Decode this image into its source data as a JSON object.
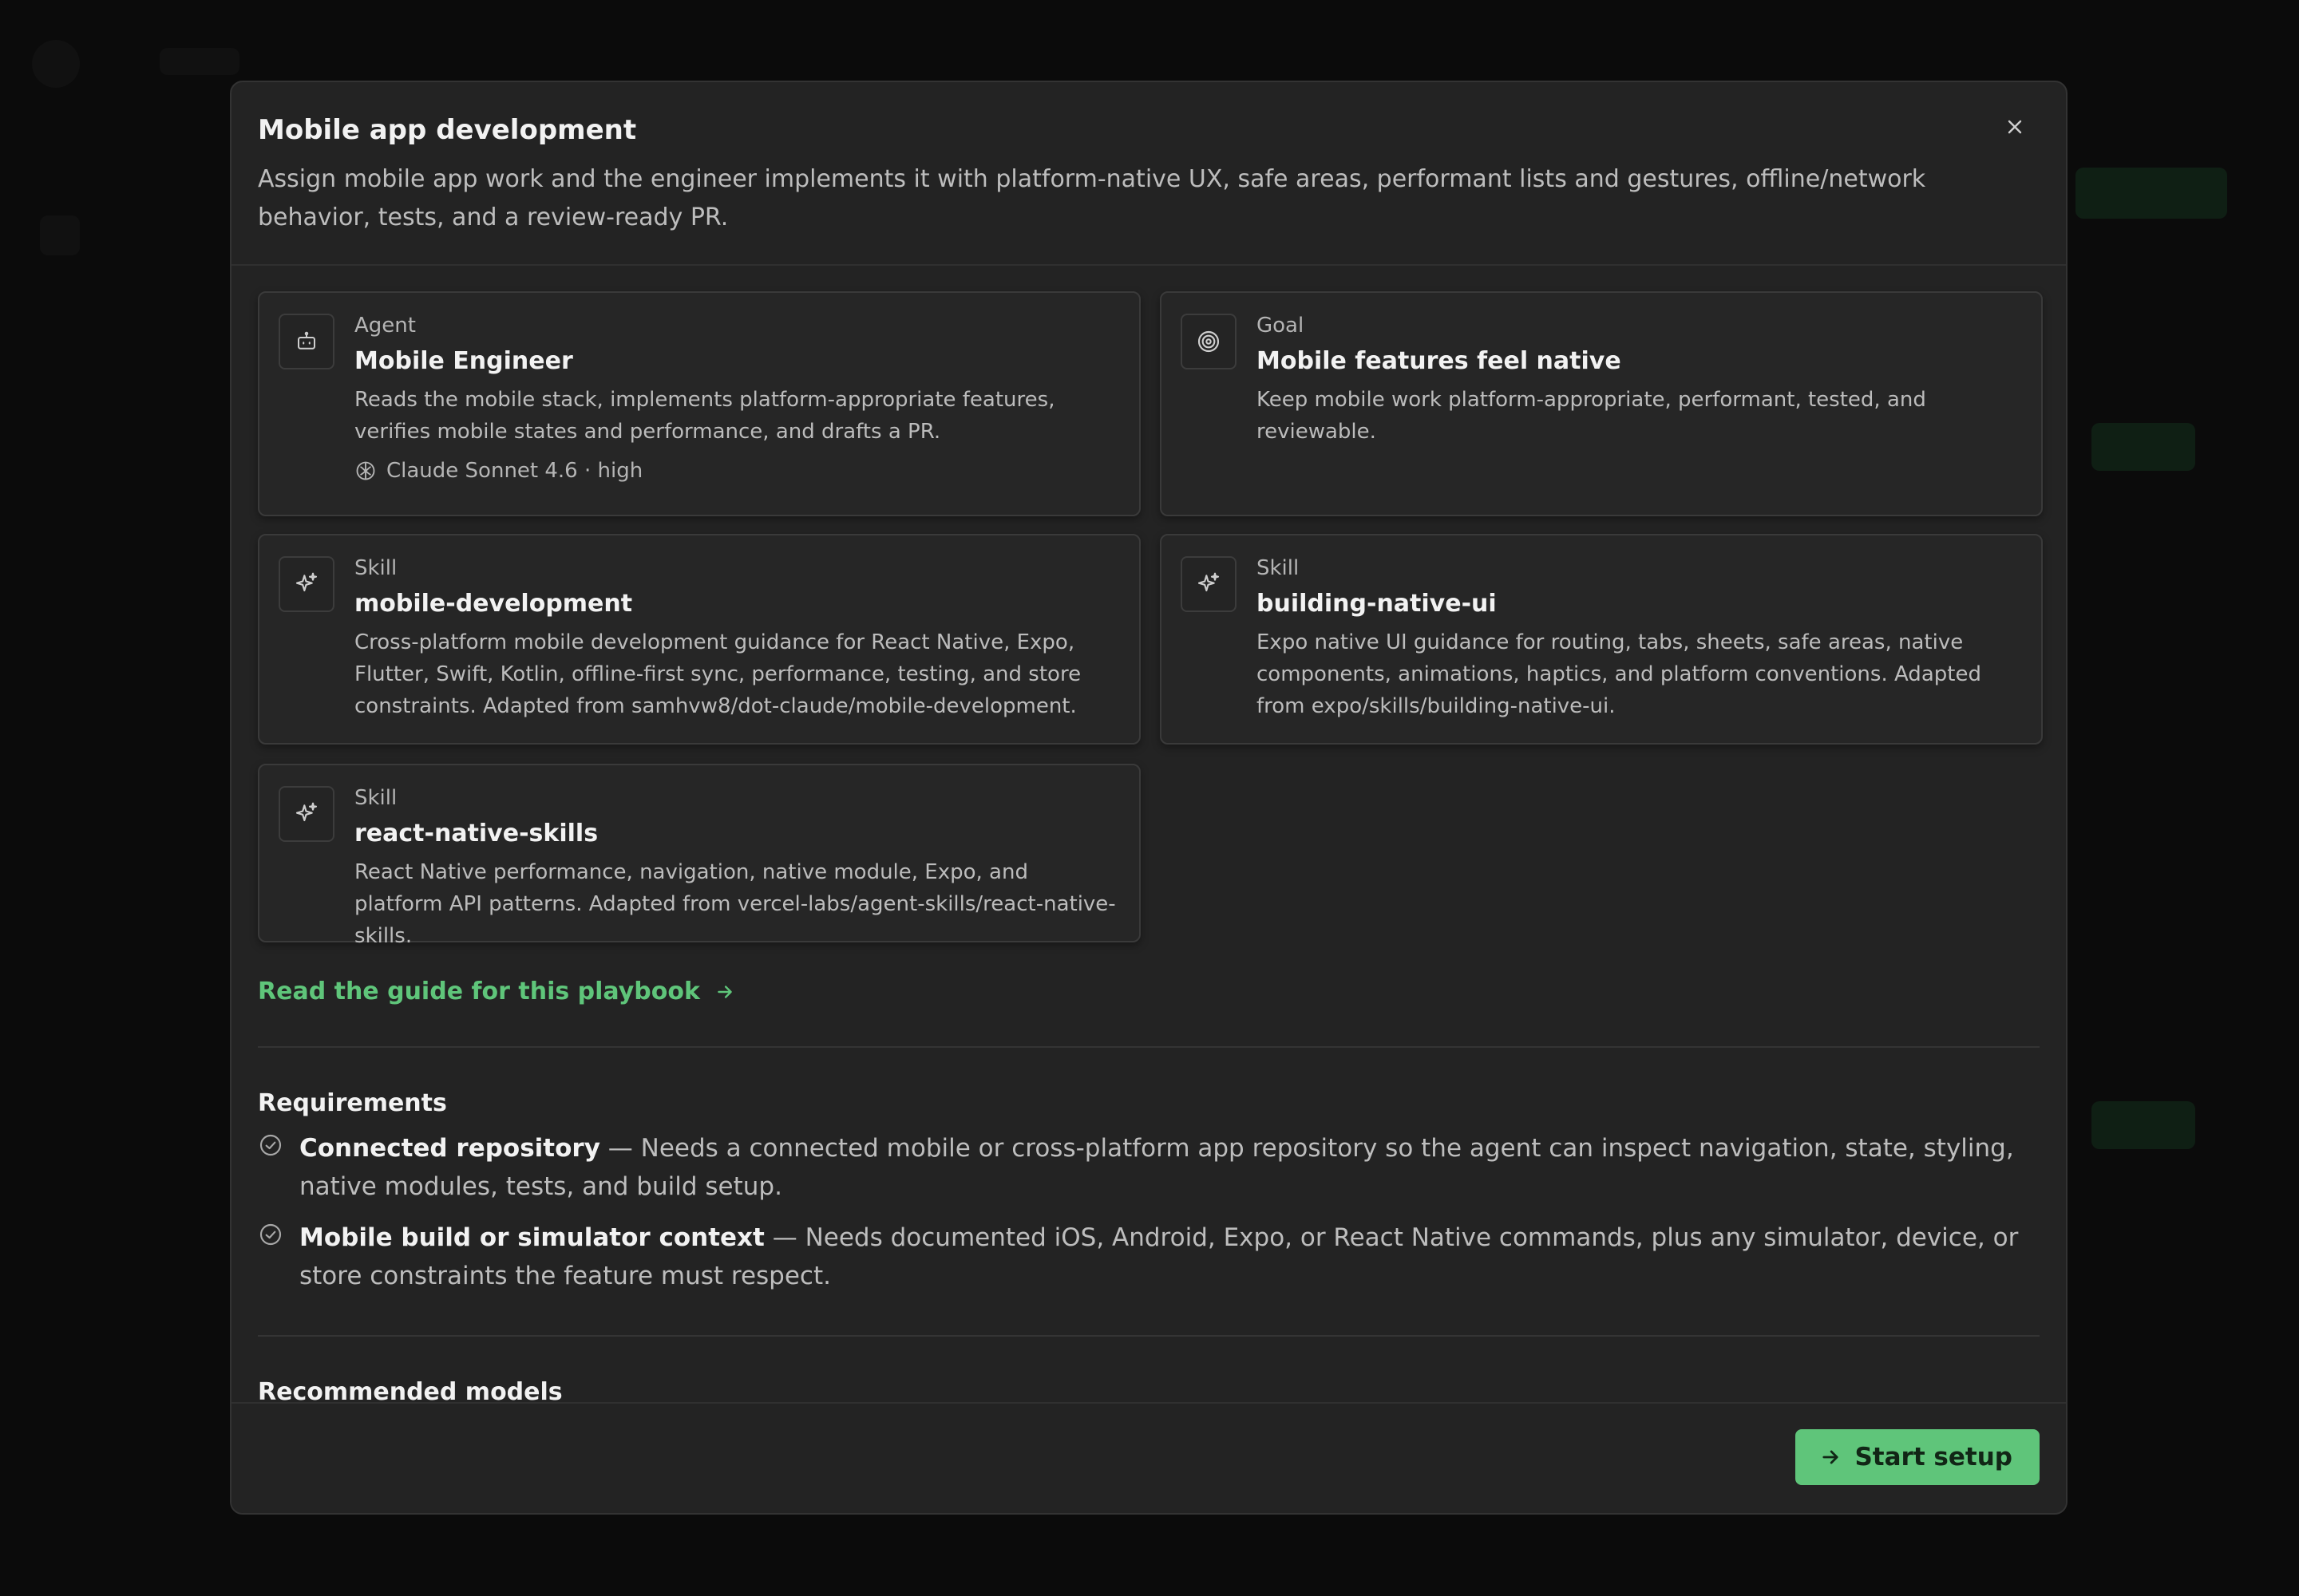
{
  "modal": {
    "title": "Mobile app development",
    "description": "Assign mobile app work and the engineer implements it with platform-native UX, safe areas, performant lists and gestures, offline/network behavior, tests, and a review-ready PR.",
    "close_icon": "close-icon"
  },
  "cards": [
    {
      "kind": "Agent",
      "name": "Mobile Engineer",
      "text": "Reads the mobile stack, implements platform-appropriate features, verifies mobile states and performance, and drafts a PR.",
      "meta": "Claude Sonnet 4.6 · high",
      "icon": "robot-icon"
    },
    {
      "kind": "Goal",
      "name": "Mobile features feel native",
      "text": "Keep mobile work platform-appropriate, performant, tested, and reviewable.",
      "icon": "target-icon"
    },
    {
      "kind": "Skill",
      "name": "mobile-development",
      "text": "Cross-platform mobile development guidance for React Native, Expo, Flutter, Swift, Kotlin, offline-first sync, performance, testing, and store constraints. Adapted from samhvw8/dot-claude/mobile-development.",
      "icon": "sparkle-icon"
    },
    {
      "kind": "Skill",
      "name": "building-native-ui",
      "text": "Expo native UI guidance for routing, tabs, sheets, safe areas, native components, animations, haptics, and platform conventions. Adapted from expo/skills/building-native-ui.",
      "icon": "sparkle-icon"
    },
    {
      "kind": "Skill",
      "name": "react-native-skills",
      "text": "React Native performance, navigation, native module, Expo, and platform API patterns. Adapted from vercel-labs/agent-skills/react-native-skills.",
      "icon": "sparkle-icon"
    }
  ],
  "guide_link": {
    "label": "Read the guide for this playbook",
    "icon": "arrow-right-icon"
  },
  "requirements": {
    "title": "Requirements",
    "items": [
      {
        "name": "Connected repository",
        "separator": " — ",
        "text": "Needs a connected mobile or cross-platform app repository so the agent can inspect navigation, state, styling, native modules, tests, and build setup."
      },
      {
        "name": "Mobile build or simulator context",
        "separator": " — ",
        "text": "Needs documented iOS, Android, Expo, or React Native commands, plus any simulator, device, or store constraints the feature must respect."
      }
    ]
  },
  "recommended_models": {
    "title": "Recommended models"
  },
  "footer": {
    "start_label": "Start setup"
  },
  "colors": {
    "accent": "#5fc57a",
    "modal_bg": "#232323",
    "card_bg": "#262626",
    "border": "#3a3a3a"
  }
}
